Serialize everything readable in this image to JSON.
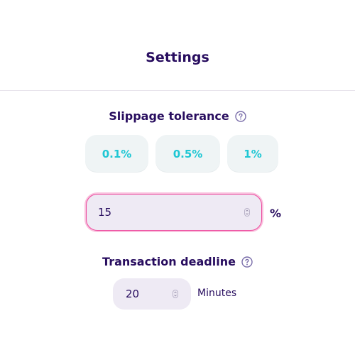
{
  "header": {
    "title": "Settings"
  },
  "slippage": {
    "heading": "Slippage tolerance",
    "help_icon": "question-circle-icon",
    "presets": [
      "0.1%",
      "0.5%",
      "1%"
    ],
    "custom_value": "15",
    "unit": "%"
  },
  "deadline": {
    "heading": "Transaction deadline",
    "help_icon": "question-circle-icon",
    "value": "20",
    "unit": "Minutes"
  },
  "colors": {
    "text_primary": "#280d5f",
    "accent_cyan": "#1fc7d4",
    "focus_pink": "#ed4b9e",
    "input_bg": "#eeeaf4",
    "preset_bg": "#eff4f5"
  }
}
